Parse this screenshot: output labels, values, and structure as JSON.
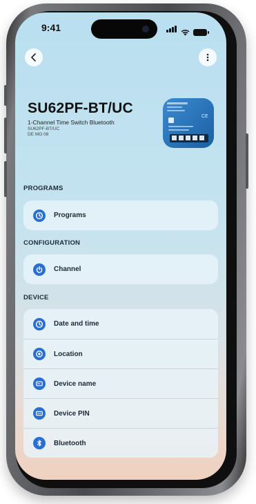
{
  "status_bar": {
    "time": "9:41"
  },
  "device": {
    "name": "SU62PF-BT/UC",
    "description": "1-Channel Time Switch Bluetooth",
    "model_line": "SU62PF-BT/UC",
    "marking_line": "DE MO 08"
  },
  "sections": [
    {
      "title": "PROGRAMS",
      "items": [
        {
          "label": "Programs",
          "icon": "clock-icon"
        }
      ]
    },
    {
      "title": "CONFIGURATION",
      "items": [
        {
          "label": "Channel",
          "icon": "power-icon"
        }
      ]
    },
    {
      "title": "DEVICE",
      "items": [
        {
          "label": "Date and time",
          "icon": "clock-icon"
        },
        {
          "label": "Location",
          "icon": "location-icon"
        },
        {
          "label": "Device name",
          "icon": "tag-icon"
        },
        {
          "label": "Device PIN",
          "icon": "pin-icon"
        },
        {
          "label": "Bluetooth",
          "icon": "bluetooth-icon"
        }
      ]
    }
  ],
  "colors": {
    "accent": "#2a6fd0",
    "screen_top": "#b9dff0",
    "screen_bottom": "#efd1c0",
    "device_body": "#1f6fb8"
  }
}
